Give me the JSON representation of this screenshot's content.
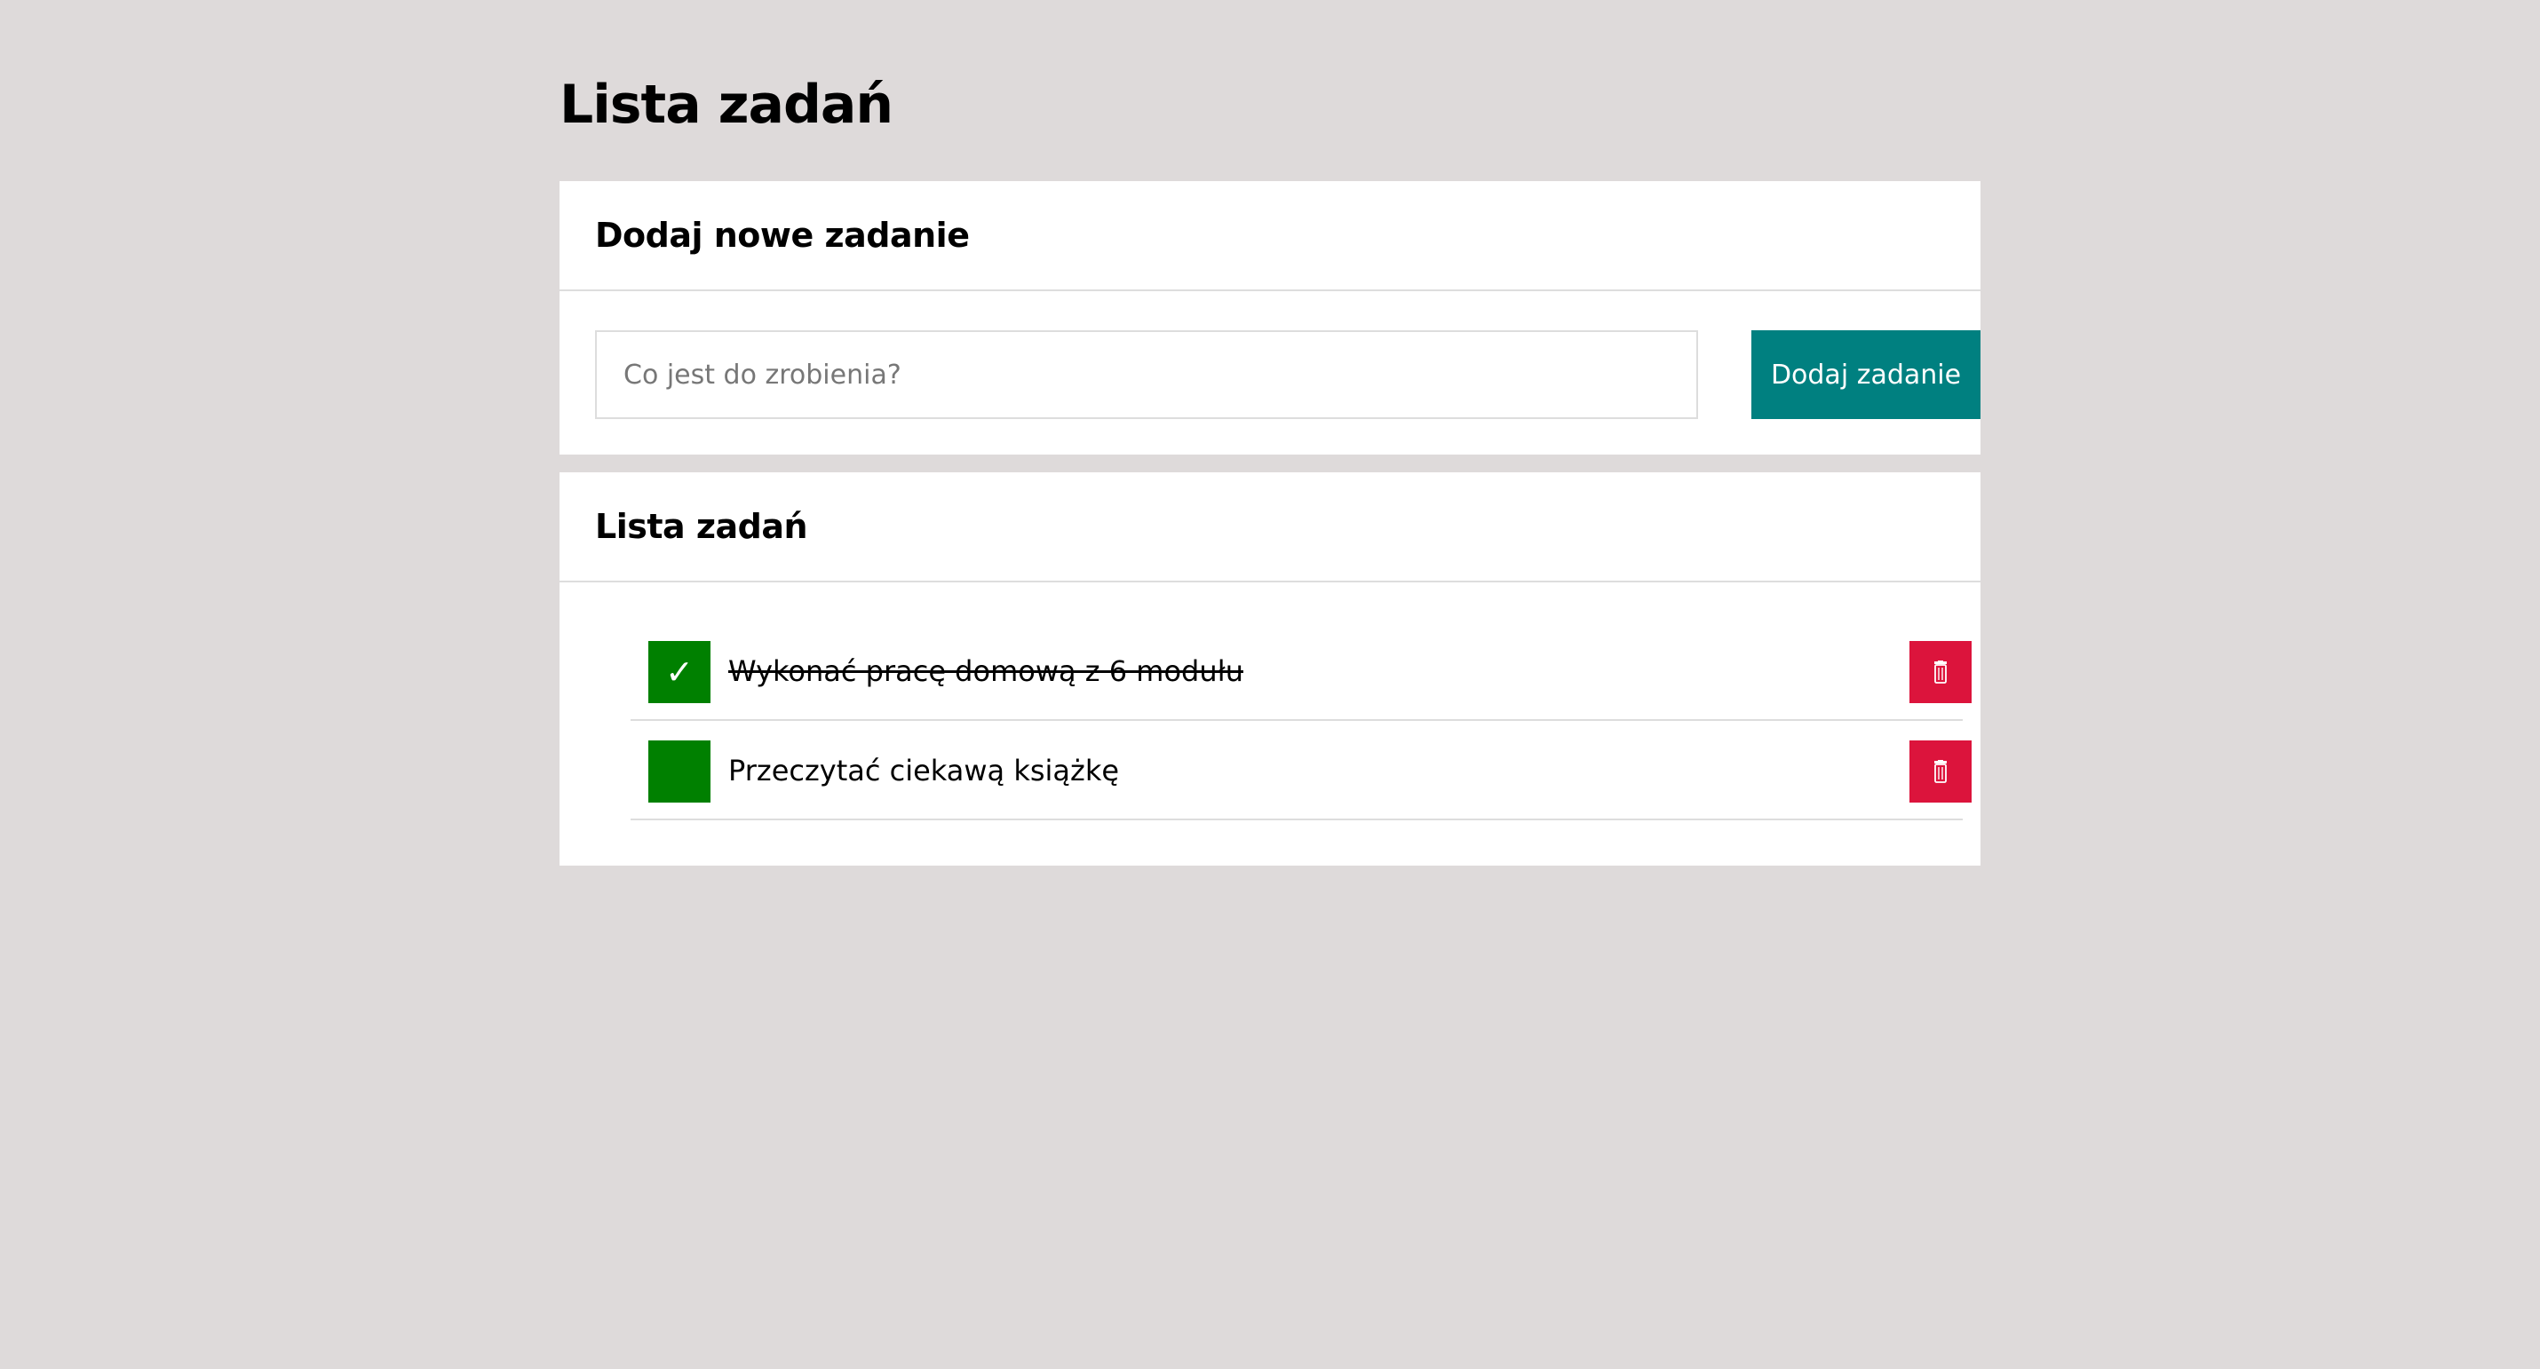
{
  "page": {
    "title": "Lista zadań"
  },
  "add_section": {
    "title": "Dodaj nowe zadanie",
    "input_placeholder": "Co jest do zrobienia?",
    "input_value": "",
    "button_label": "Dodaj zadanie"
  },
  "list_section": {
    "title": "Lista zadań",
    "tasks": [
      {
        "text": "Wykonać pracę domową z 6 modułu",
        "done": true,
        "check_icon": "✓"
      },
      {
        "text": "Przeczytać ciekawą książkę",
        "done": false,
        "check_icon": ""
      }
    ],
    "delete_icon": "trash-icon"
  },
  "colors": {
    "background": "#dedada",
    "panel": "#ffffff",
    "add_button": "#008080",
    "toggle_button": "#008000",
    "delete_button": "#dc143c",
    "divider": "#dddddd"
  }
}
